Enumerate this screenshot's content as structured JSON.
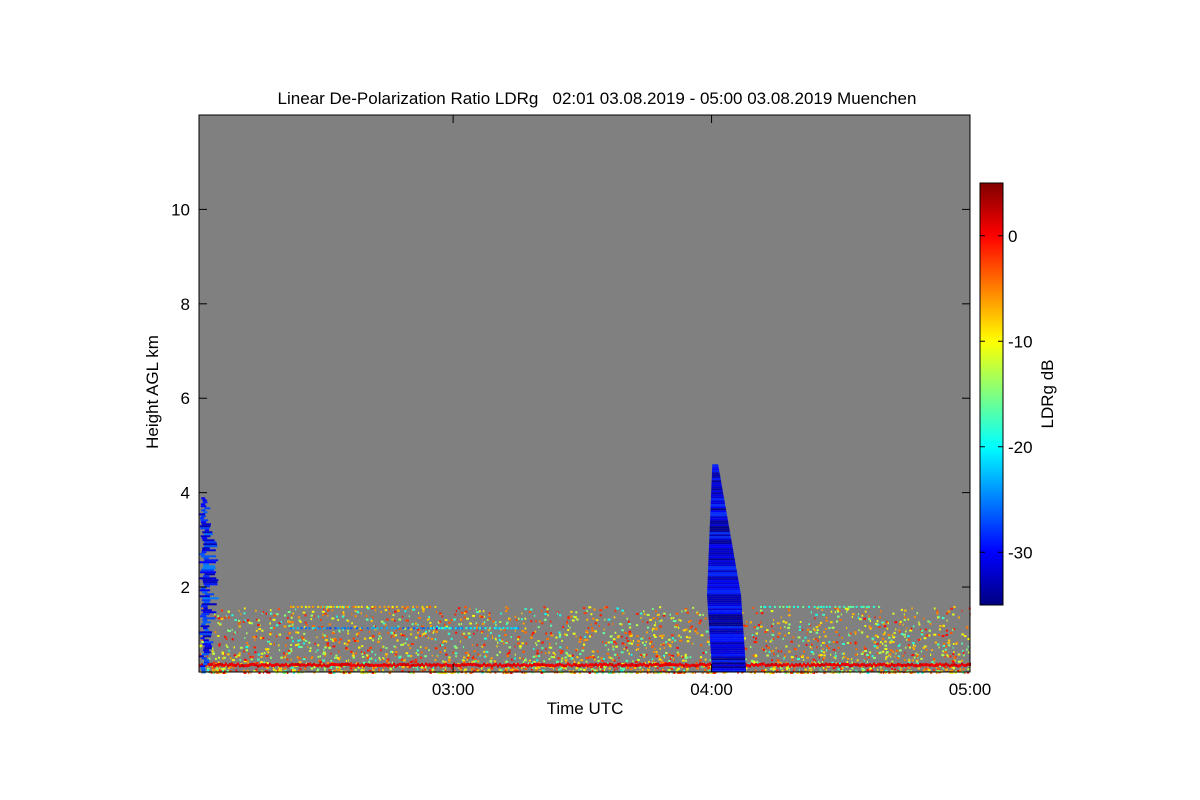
{
  "chart_data": {
    "type": "heatmap",
    "title": "Linear De-Polarization Ratio LDRg   02:01 03.08.2019 - 05:00 03.08.2019 Muenchen",
    "xlabel": "Time UTC",
    "ylabel": "Height AGL km",
    "colorbar_label": "LDRg dB",
    "x_range": [
      "02:01",
      "05:00"
    ],
    "x_ticks": [
      {
        "value": "03:00",
        "label": "03:00"
      },
      {
        "value": "04:00",
        "label": "04:00"
      },
      {
        "value": "05:00",
        "label": "05:00"
      }
    ],
    "ylim": [
      0.2,
      12
    ],
    "y_ticks": [
      2,
      4,
      6,
      8,
      10
    ],
    "y_tick_labels": [
      "2",
      "4",
      "6",
      "8",
      "10"
    ],
    "clim": [
      -35,
      5
    ],
    "colorbar_ticks": [
      0,
      -10,
      -20,
      -30
    ],
    "colorbar_tick_labels": [
      "0",
      "-10",
      "-20",
      "-30"
    ],
    "colormap": "jet",
    "background_color": "#808080",
    "features": [
      {
        "name": "low-level aerosol layer",
        "x_range": [
          "02:01",
          "05:00"
        ],
        "height_km": [
          0.2,
          1.6
        ],
        "ldr_db": [
          -20,
          0
        ]
      },
      {
        "name": "surface band",
        "x_range": [
          "02:01",
          "05:00"
        ],
        "height_km": [
          0.3,
          0.4
        ],
        "ldr_db": [
          0,
          2
        ]
      },
      {
        "name": "precipitation streak",
        "x_range": [
          "02:01",
          "02:05"
        ],
        "height_km": [
          0.2,
          3.9
        ],
        "ldr_db": [
          -33,
          -25
        ]
      },
      {
        "name": "precipitation shaft",
        "x_range": [
          "03:59",
          "04:10"
        ],
        "height_km": [
          0.2,
          4.6
        ],
        "ldr_db": [
          -35,
          -28
        ]
      }
    ]
  }
}
